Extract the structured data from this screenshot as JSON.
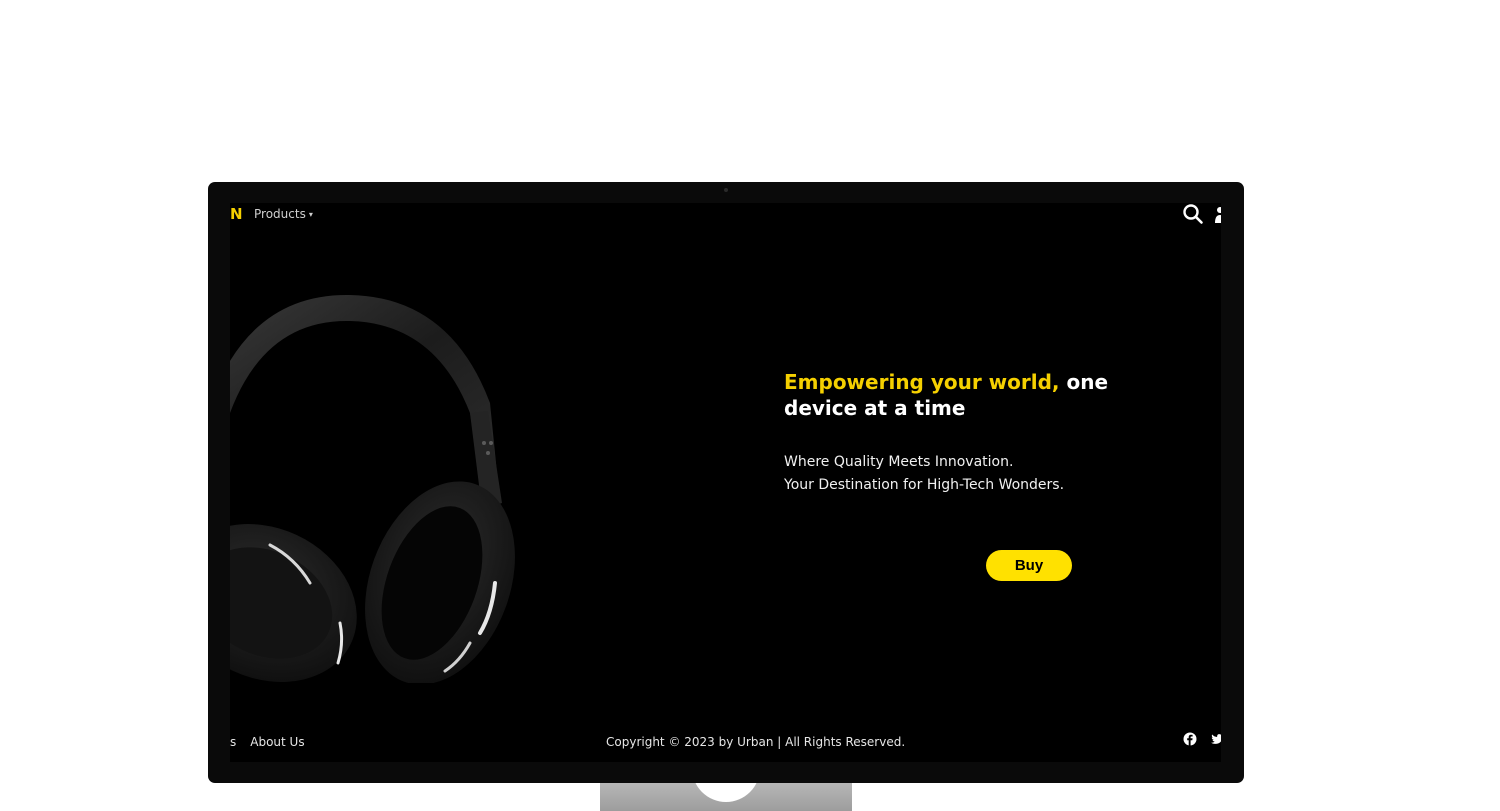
{
  "nav": {
    "logo_letter": "N",
    "products_label": "Products",
    "caret": "▾"
  },
  "icons": {
    "search": "search-icon",
    "user": "user-icon",
    "facebook": "facebook-icon",
    "twitter": "twitter-icon"
  },
  "hero": {
    "headline_highlight": "Empowering your world,",
    "headline_rest": "one device at a time",
    "sub_line1": "Where Quality Meets Innovation.",
    "sub_line2": "Your Destination for High-Tech Wonders.",
    "buy_label": "Buy"
  },
  "footer": {
    "left_partial": "s",
    "about_label": "About Us",
    "copyright": "Copyright © 2023 by Urban | All Rights Reserved."
  },
  "colors": {
    "accent": "#f5d000",
    "button": "#ffe100",
    "screen_bg": "#000000"
  }
}
